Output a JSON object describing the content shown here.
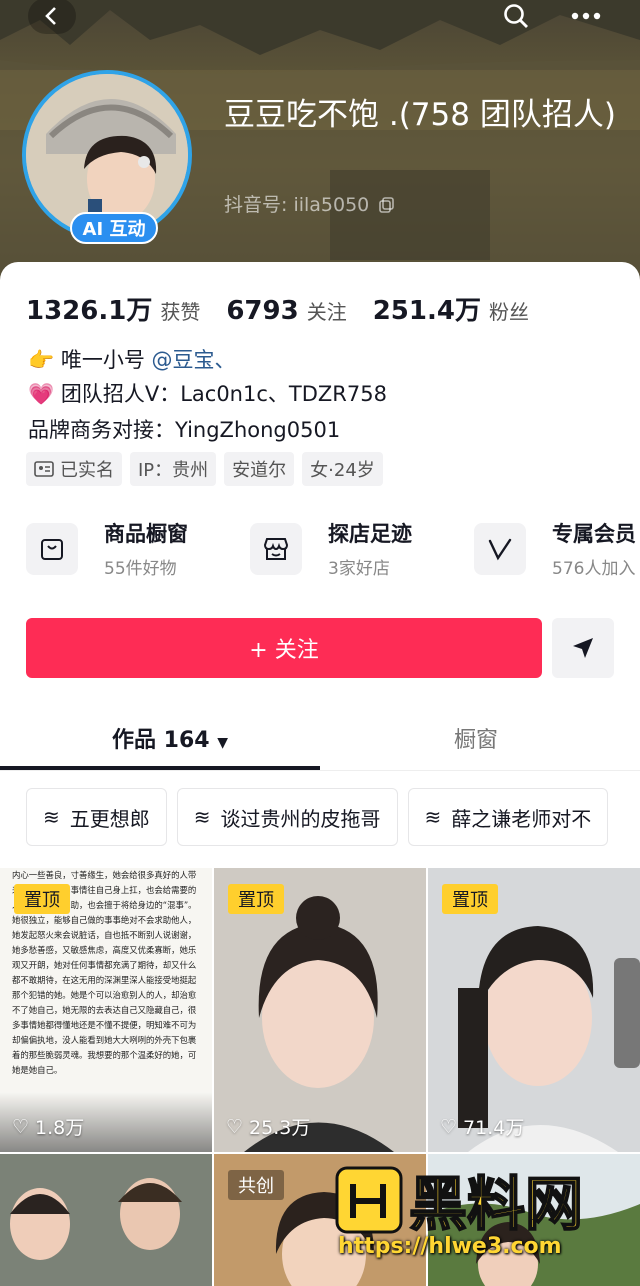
{
  "profile": {
    "name": "豆豆吃不饱 .(758 团队招人)",
    "douyin_id": "抖音号: iila5050",
    "ai_badge": "AI 互动"
  },
  "stats": [
    {
      "num": "1326.1万",
      "label": "获赞"
    },
    {
      "num": "6793",
      "label": "关注"
    },
    {
      "num": "251.4万",
      "label": "粉丝"
    }
  ],
  "bio": {
    "line1_prefix": "唯一小号",
    "line1_mention": "@豆宝、",
    "line2": "团队招人V：Lac0n1c、TDZR758",
    "line3": "品牌商务对接：YingZhong0501"
  },
  "tags": [
    "已实名",
    "IP：贵州",
    "安道尔",
    "女·24岁"
  ],
  "services": [
    {
      "title": "商品橱窗",
      "sub": "55件好物",
      "icon": "bag-icon"
    },
    {
      "title": "探店足迹",
      "sub": "3家好店",
      "icon": "shop-icon"
    },
    {
      "title": "专属会员",
      "sub": "576人加入",
      "icon": "v-icon"
    }
  ],
  "follow_label": "+ 关注",
  "tabs": {
    "works": "作品 164",
    "showcase": "橱窗"
  },
  "collections": [
    "五更想郎",
    "谈过贵州的皮拖哥",
    "薛之谦老师对不"
  ],
  "videos": [
    {
      "badge": "置顶",
      "likes": "1.8万"
    },
    {
      "badge": "置顶",
      "likes": "25.3万"
    },
    {
      "badge": "置顶",
      "likes": "71.4万"
    },
    {
      "badge": "",
      "likes": ""
    },
    {
      "badge": "共创",
      "likes": ""
    },
    {
      "badge": "",
      "likes": ""
    }
  ],
  "doc_text": "内心一些善良，寸善缘生，她会给很多真好的人带来快乐，把很多事情往自己身上扛，也会给需要的人带去温暖与帮助，也会擅于将给身边的“混事”。她很独立，能够自己做的事事绝对不会求助他人，她发起怒火来会说脏话，自也抵不断别人说谢谢，她多愁善感，又敏感焦虑，高度又优柔寡断，她乐观又开朗，她对任何事情都充满了期待，却又什么都不敢期待，在这无用的深渊里深人能接受地挺起那个犯错的她。她是个可以治愈别人的人，却治愈不了她自己，她无限的去表达自己又隐藏自己，很多事情她都得懂地还是不懂不提便，明知难不可为却偏偏执地，没人能看到她大大咧咧的外壳下包裹着的那些脆弱灵魂。我想要的那个温柔好的她，可她是她自己。",
  "watermark": {
    "brand": "黑料网",
    "url": "https://hlwe3.com"
  },
  "colors": {
    "accent": "#fe2c55",
    "pin": "#ffcf2d",
    "mention": "#2b5a8f"
  }
}
